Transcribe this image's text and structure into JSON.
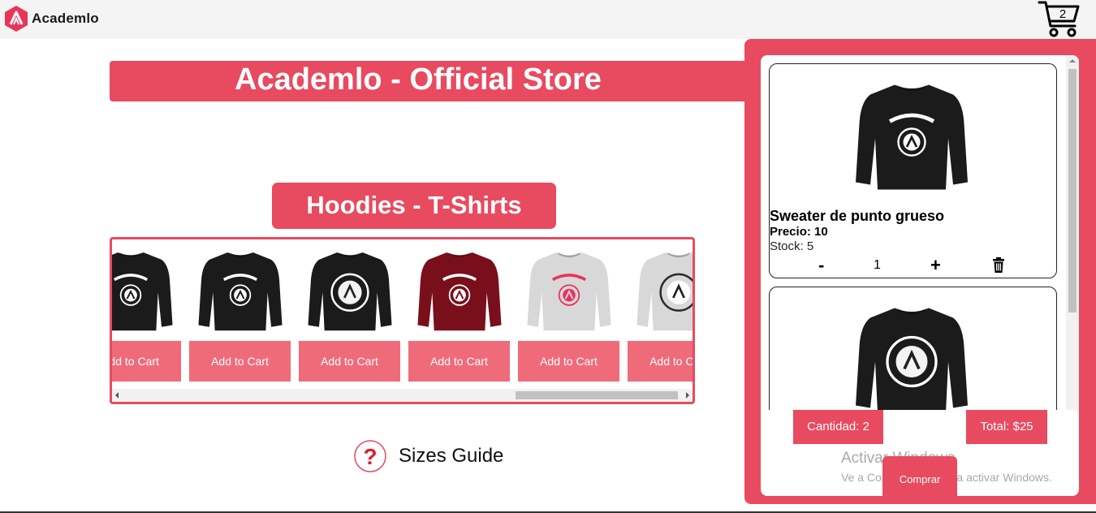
{
  "header": {
    "brand": "Academlo",
    "cart_count": "2",
    "cart_icon": "shopping-cart-icon"
  },
  "store": {
    "title": "Academlo - Official Store",
    "section_title": "Hoodies - T-Shirts"
  },
  "products": [
    {
      "button_label": "Add to Cart",
      "color": "#1b1b1b",
      "print": "#ffffff",
      "variant": "arc"
    },
    {
      "button_label": "Add to Cart",
      "color": "#1b1b1b",
      "print": "#ffffff",
      "variant": "arc"
    },
    {
      "button_label": "Add to Cart",
      "color": "#1b1b1b",
      "print": "#ffffff",
      "variant": "circle"
    },
    {
      "button_label": "Add to Cart",
      "color": "#7a0f1c",
      "print": "#ffffff",
      "variant": "arc"
    },
    {
      "button_label": "Add to Cart",
      "color": "#d8d8d8",
      "print": "#e8345a",
      "variant": "arc"
    },
    {
      "button_label": "Add to Cart",
      "color": "#d8d8d8",
      "print": "#2b2b2b",
      "variant": "circle"
    }
  ],
  "sizes_guide": {
    "label": "Sizes Guide",
    "icon": "question-mark-icon"
  },
  "cart": {
    "items": [
      {
        "name": "Sweater de punto grueso",
        "price": "Precio: 10",
        "stock": "Stock: 5",
        "quantity": "1",
        "minus": "-",
        "plus": "+",
        "variant": "arc"
      },
      {
        "variant": "circle"
      }
    ],
    "quantity_label": "Cantidad: 2",
    "total_label": "Total: $25",
    "buy_label": "Comprar"
  },
  "watermark": {
    "title": "Activar Windows",
    "subtitle": "Ve a Configuración para activar Windows."
  },
  "colors": {
    "accent": "#e84a5f",
    "button": "#f06b7a"
  }
}
